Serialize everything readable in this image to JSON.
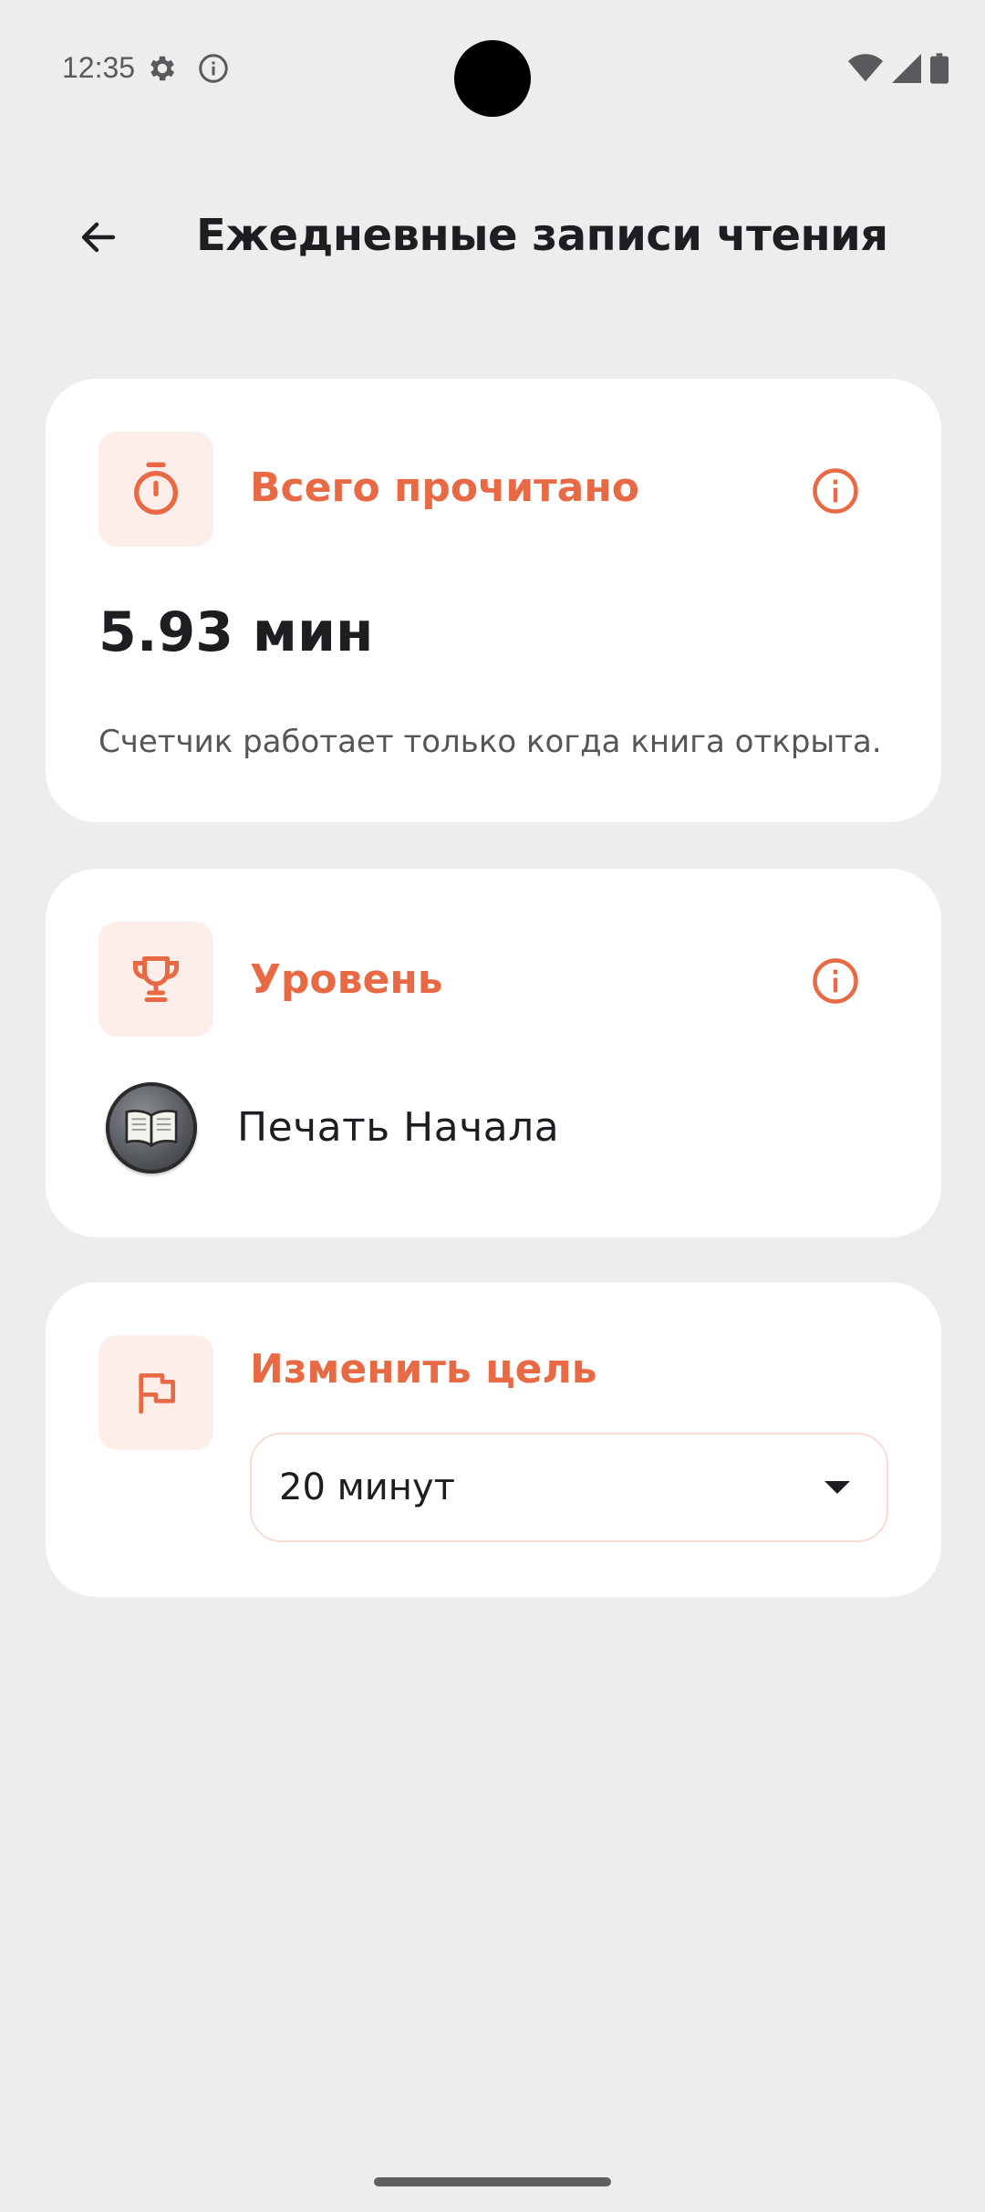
{
  "status_bar": {
    "time": "12:35",
    "icons": [
      "gear-icon",
      "info-icon",
      "wifi-icon",
      "signal-icon",
      "battery-icon"
    ]
  },
  "app_bar": {
    "back_icon": "arrow-left-icon",
    "title": "Ежедневные записи чтения"
  },
  "cards": {
    "total": {
      "icon": "timer-icon",
      "heading": "Всего прочитано",
      "value": "5.93 мин",
      "note": "Счетчик работает только когда книга открыта."
    },
    "level": {
      "icon": "trophy-icon",
      "heading": "Уровень",
      "badge_icon": "open-book-icon",
      "name": "Печать Начала"
    },
    "goal": {
      "icon": "flag-icon",
      "heading": "Изменить цель",
      "selected": "20 минут"
    }
  },
  "colors": {
    "accent": "#e86a44",
    "tile_bg": "#fdeeea",
    "background": "#ededed",
    "card": "#ffffff"
  }
}
